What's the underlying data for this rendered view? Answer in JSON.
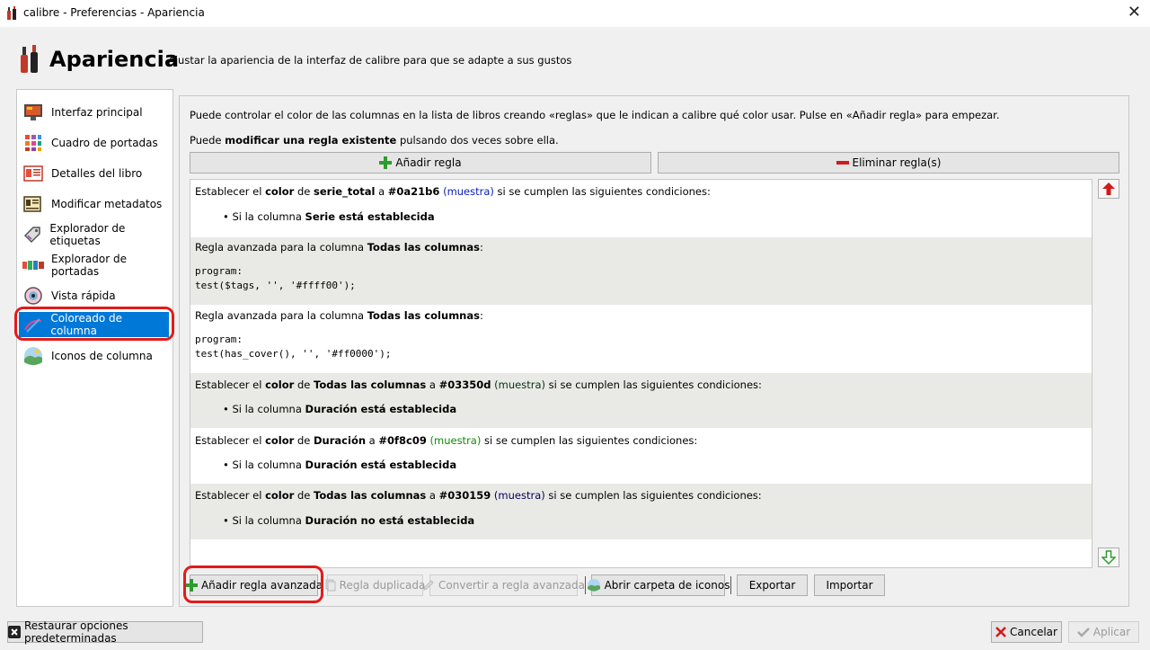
{
  "window": {
    "title": "calibre - Preferencias - Apariencia",
    "close_glyph": "✕"
  },
  "header": {
    "title": "Apariencia",
    "subtitle": "Ajustar la apariencia de la interfaz de calibre para que se adapte a sus gustos"
  },
  "sidebar": {
    "items": [
      {
        "label": "Interfaz principal",
        "icon": "monitor-icon"
      },
      {
        "label": "Cuadro de portadas",
        "icon": "cover-grid-icon"
      },
      {
        "label": "Detalles del libro",
        "icon": "book-details-icon"
      },
      {
        "label": "Modificar metadatos",
        "icon": "edit-metadata-icon"
      },
      {
        "label": "Explorador de etiquetas",
        "icon": "tag-icon"
      },
      {
        "label": "Explorador de portadas",
        "icon": "cover-browser-icon"
      },
      {
        "label": "Vista rápida",
        "icon": "eye-icon"
      },
      {
        "label": "Coloreado de columna",
        "icon": "column-color-icon",
        "selected": true
      },
      {
        "label": "Iconos de columna",
        "icon": "landscape-icon"
      }
    ]
  },
  "panel": {
    "intro": "Puede controlar el color de las columnas en la lista de libros creando «reglas» que le indican a calibre qué color usar. Pulse en «Añadir regla» para empezar.",
    "hint_prefix": "Puede ",
    "hint_bold": "modificar una regla existente",
    "hint_suffix": " pulsando dos veces sobre ella.",
    "add_rule_label": "Añadir regla",
    "remove_rule_label": "Eliminar regla(s)"
  },
  "rules": [
    {
      "type": "simple",
      "prefix": "Establecer el ",
      "kw_color": "color",
      "de": " de ",
      "column": "serie_total",
      "a": " a ",
      "color": "#0a21b6",
      "sample": "(muestra)",
      "suffix": " si se cumplen las siguientes condiciones:",
      "cond_prefix": "Si la columna ",
      "cond_bold": "Serie está establecida",
      "sample_color": "#0a21b6"
    },
    {
      "type": "advanced",
      "prefix": "Regla avanzada para la columna ",
      "column": "Todas las columnas",
      "colon": ":",
      "code": "program:\ntest($tags, '', '#ffff00');"
    },
    {
      "type": "advanced",
      "prefix": "Regla avanzada para la columna ",
      "column": "Todas las columnas",
      "colon": ":",
      "code": "program:\ntest(has_cover(), '', '#ff0000');"
    },
    {
      "type": "simple",
      "prefix": "Establecer el ",
      "kw_color": "color",
      "de": " de ",
      "column": "Todas las columnas",
      "a": " a ",
      "color": "#03350d",
      "sample": "(muestra)",
      "suffix": " si se cumplen las siguientes condiciones:",
      "cond_prefix": "Si la columna ",
      "cond_bold": "Duración está establecida",
      "sample_color": "#03350d"
    },
    {
      "type": "simple",
      "prefix": "Establecer el ",
      "kw_color": "color",
      "de": " de ",
      "column": "Duración",
      "a": " a ",
      "color": "#0f8c09",
      "sample": "(muestra)",
      "suffix": " si se cumplen las siguientes condiciones:",
      "cond_prefix": "Si la columna ",
      "cond_bold": "Duración está establecida",
      "sample_color": "#0f8c09"
    },
    {
      "type": "simple",
      "prefix": "Establecer el ",
      "kw_color": "color",
      "de": " de ",
      "column": "Todas las columnas",
      "a": " a ",
      "color": "#030159",
      "sample": "(muestra)",
      "suffix": " si se cumplen las siguientes condiciones:",
      "cond_prefix": "Si la columna ",
      "cond_bold": "Duración no está establecida",
      "sample_color": "#030159"
    }
  ],
  "toolbar": {
    "add_advanced": "Añadir regla avanzada",
    "duplicate": "Regla duplicada",
    "convert": "Convertir a regla avanzada",
    "open_icons": "Abrir carpeta de iconos",
    "export": "Exportar",
    "import": "Importar"
  },
  "footer": {
    "restore": "Restaurar opciones predeterminadas",
    "cancel": "Cancelar",
    "apply": "Aplicar"
  },
  "colors": {
    "selection": "#0078d7",
    "highlight": "#e21b1b",
    "add_green": "#2e9b2e",
    "remove_red": "#d11a1a"
  }
}
